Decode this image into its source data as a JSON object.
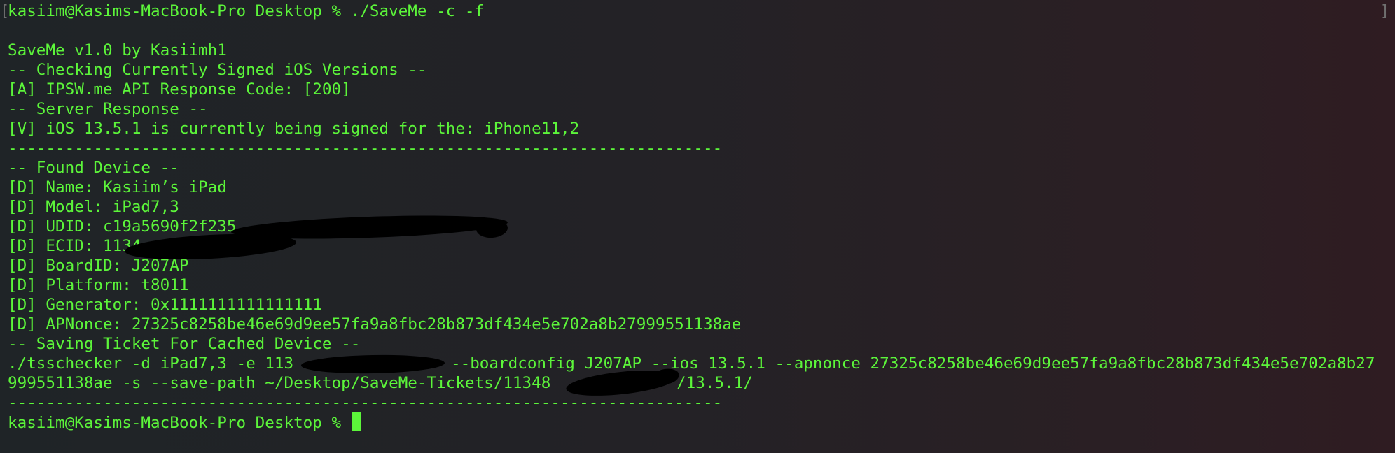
{
  "terminal": {
    "scroll_marker": "]",
    "line_00": "kasiim@Kasims-MacBook-Pro Desktop % ./SaveMe -c -f",
    "line_01": "",
    "line_02": "SaveMe v1.0 by Kasiimh1",
    "line_03": "-- Checking Currently Signed iOS Versions --",
    "line_04": "[A] IPSW.me API Response Code: [200]",
    "line_05": "-- Server Response --",
    "line_06": "[V] iOS 13.5.1 is currently being signed for the: iPhone11,2",
    "line_07": "---------------------------------------------------------------------------",
    "line_08": "-- Found Device --",
    "line_09": "[D] Name: Kasiim’s iPad",
    "line_10": "[D] Model: iPad7,3",
    "line_11": "[D] UDID: c19a5690f2f235",
    "line_12": "[D] ECID: 1134",
    "line_13": "[D] BoardID: J207AP",
    "line_14": "[D] Platform: t8011",
    "line_15": "[D] Generator: 0x1111111111111111",
    "line_16": "[D] APNonce: 27325c8258be46e69d9ee57fa9a8fbc28b873df434e5e702a8b27999551138ae",
    "line_17": "-- Saving Ticket For Cached Device --",
    "line_18a": "./tsschecker -d iPad7,3 -e 113",
    "line_18b": "--boardconfig J207AP --ios 13.5.1 --apnonce 27325c8258be46e69d9ee57fa9a8fbc28b873df434e5e702a8b27",
    "line_19a": "999551138ae -s --save-path ~/Desktop/SaveMe-Tickets/11348",
    "line_19b": "/13.5.1/",
    "line_20": "---------------------------------------------------------------------------",
    "line_21": "kasiim@Kasims-MacBook-Pro Desktop % "
  }
}
